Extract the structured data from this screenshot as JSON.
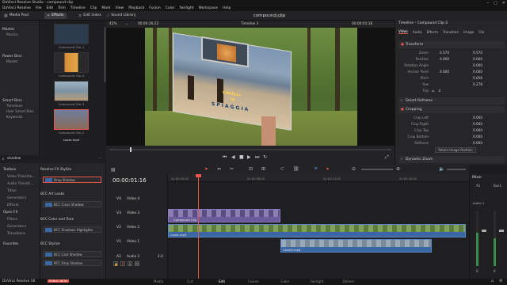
{
  "window": {
    "title": "DaVinci Resolve Studio - compound clip"
  },
  "menu": [
    "DaVinci Resolve",
    "File",
    "Edit",
    "Trim",
    "Timeline",
    "Clip",
    "Mark",
    "View",
    "Playback",
    "Fusion",
    "Color",
    "Fairlight",
    "Workspace",
    "Help"
  ],
  "toolbar": {
    "media_pool": "Media Pool",
    "effects": "Effects",
    "edit_index": "Edit Index",
    "sound_library": "Sound Library",
    "project_title": "compound clip",
    "project_status": "Edited",
    "mixer": "Mixer",
    "metadata": "Metadata",
    "inspector": "Inspector"
  },
  "media_pool": {
    "sections": [
      {
        "header": "Master",
        "items": [
          "Musica"
        ]
      },
      {
        "header": "Power Bins",
        "items": [
          "Master"
        ]
      },
      {
        "header": "Smart Bins",
        "items": [
          "Timelines",
          "User Smart Bins",
          "Keywords"
        ]
      }
    ],
    "clips": [
      "Compound Clip 1",
      "Compound Clip 4",
      "Compound Clip 3",
      "Compound Clip 2",
      "cuore.mp4"
    ]
  },
  "viewer": {
    "zoom": "42%",
    "source_timecode": "00:00:26:22",
    "timeline_name": "Timeline 3",
    "record_timecode": "00:00:01:16",
    "overlay_text": [
      "CAVALLI",
      "IN",
      "SPIAGGIA"
    ]
  },
  "inspector": {
    "title": "Timeline - Compound Clip 2",
    "tabs": [
      "Video",
      "Audio",
      "Effects",
      "Transition",
      "Image",
      "File"
    ],
    "transform_label": "Transform",
    "transform": [
      {
        "label": "Zoom",
        "x": "0.570",
        "y": "0.570"
      },
      {
        "label": "Position",
        "x": "0.000",
        "y": "0.000"
      },
      {
        "label": "Rotation Angle",
        "x": "0.000"
      },
      {
        "label": "Anchor Point",
        "x": "0.000",
        "y": "0.000"
      },
      {
        "label": "Pitch",
        "x": "0.056"
      },
      {
        "label": "Yaw",
        "x": "0.278"
      },
      {
        "label": "Flip",
        "x": ""
      }
    ],
    "smart_reframe": "Smart Reframe",
    "cropping_label": "Cropping",
    "cropping": [
      {
        "label": "Crop Left",
        "x": "0.000"
      },
      {
        "label": "Crop Right",
        "x": "0.000"
      },
      {
        "label": "Crop Top",
        "x": "0.000"
      },
      {
        "label": "Crop Bottom",
        "x": "0.000"
      },
      {
        "label": "Softness",
        "x": "0.000"
      }
    ],
    "retain_button": "Retain Image Position",
    "dynamic_zoom": "Dynamic Zoom"
  },
  "effects": {
    "search_value": "shadow",
    "tree": [
      "Toolbox",
      "Video Transitio...",
      "Audio Transiti...",
      "Titles",
      "Generators",
      "Effects",
      "Open FX",
      "Filters",
      "Generators",
      "Transitions"
    ],
    "favorites": "Favorites",
    "groups": [
      {
        "name": "Resolve FX Stylize",
        "items": [
          "Drop Shadow"
        ]
      },
      {
        "name": "BCC Art Looks",
        "items": [
          "BCC Cross Shadow"
        ]
      },
      {
        "name": "BCC Color and Tone",
        "items": [
          "BCC Shadows Highlights"
        ]
      },
      {
        "name": "BCC Stylize",
        "items": [
          "BCC Cast Shadow",
          "BCC Drop Shadow"
        ]
      }
    ]
  },
  "timeline": {
    "timecode": "00:00:01:16",
    "ruler": [
      "01:00:00:00",
      "01:00:06:00",
      "01:00:12:00",
      "01:00:18:00"
    ],
    "tracks": [
      {
        "id": "V4",
        "name": "Video 4"
      },
      {
        "id": "V3",
        "name": "Video 3"
      },
      {
        "id": "V2",
        "name": "Video 2"
      },
      {
        "id": "V1",
        "name": "Video 1"
      },
      {
        "id": "A1",
        "name": "Audio 1",
        "level": "2.0"
      }
    ],
    "clips": {
      "v3": "Compound Clip",
      "v2": "cuore.mp4",
      "v1": "Cavalli.mp4"
    }
  },
  "mixer": {
    "title": "Mixer",
    "channels": [
      "A1",
      "Bus1"
    ],
    "track_label": "Audio 1",
    "values": [
      "0",
      "0"
    ]
  },
  "pages": [
    "Media",
    "Cut",
    "Edit",
    "Fusion",
    "Color",
    "Fairlight",
    "Deliver"
  ],
  "footer": {
    "app": "DaVinci Resolve 18",
    "badge": "PUBLIC BETA"
  },
  "colors": {
    "accent": "#e5554f",
    "clip_purple": "#6b5b9a",
    "clip_blue": "#3c67a5",
    "audio_green": "#3c8a4c"
  }
}
